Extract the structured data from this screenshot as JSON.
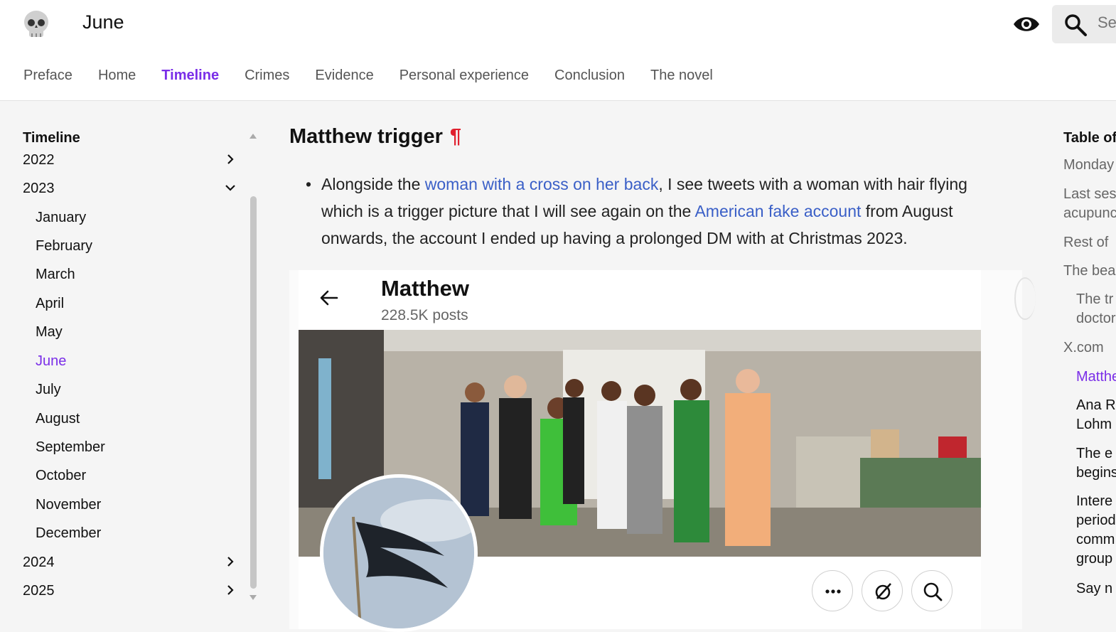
{
  "header": {
    "site_title": "June",
    "search_placeholder": "Search"
  },
  "topnav": [
    {
      "label": "Preface",
      "active": false
    },
    {
      "label": "Home",
      "active": false
    },
    {
      "label": "Timeline",
      "active": true
    },
    {
      "label": "Crimes",
      "active": false
    },
    {
      "label": "Evidence",
      "active": false
    },
    {
      "label": "Personal experience",
      "active": false
    },
    {
      "label": "Conclusion",
      "active": false
    },
    {
      "label": "The novel",
      "active": false
    }
  ],
  "sidebar": {
    "title": "Timeline",
    "years": [
      "2022",
      "2023",
      "2024",
      "2025"
    ],
    "months": [
      "January",
      "February",
      "March",
      "April",
      "May",
      "June",
      "July",
      "August",
      "September",
      "October",
      "November",
      "December"
    ],
    "active_month": "June"
  },
  "article": {
    "heading": "Matthew trigger",
    "pilcrow": "¶",
    "text_1": "Alongside the ",
    "link_1": "woman with a cross on her back",
    "text_2": ", I see tweets with a woman with hair flying which is a trigger picture that I will see again on the ",
    "link_2": "American fake account",
    "text_3": " from August onwards, the account I ended up having a prolonged DM with at Christmas 2023."
  },
  "tweet_card": {
    "profile_name": "Matthew",
    "post_count": "228.5K posts"
  },
  "toc": {
    "title": "Table of contents",
    "items": [
      {
        "label": "Monday",
        "level": 0
      },
      {
        "label": "Last session",
        "label_2": "acupuncture",
        "level": 0
      },
      {
        "label": "Rest of",
        "level": 0
      },
      {
        "label": "The beach",
        "level": 0
      },
      {
        "label": "The tr",
        "label_2": "doctor",
        "level": 1
      },
      {
        "label": "X.com",
        "level": 0
      },
      {
        "label": "Matthew",
        "level": 1,
        "active": true
      },
      {
        "label": "Ana R",
        "label_2": "Lohm",
        "level": 1
      },
      {
        "label": "The e",
        "label_2": "begins",
        "level": 1
      },
      {
        "label": "Intere",
        "label_2": "period",
        "label_3": "comm",
        "label_4": "group",
        "level": 1
      },
      {
        "label": "Say n",
        "level": 1
      }
    ]
  },
  "colors": {
    "accent": "#7a2ee8",
    "link": "#3a5fc7",
    "pilcrow": "#e0202e"
  }
}
